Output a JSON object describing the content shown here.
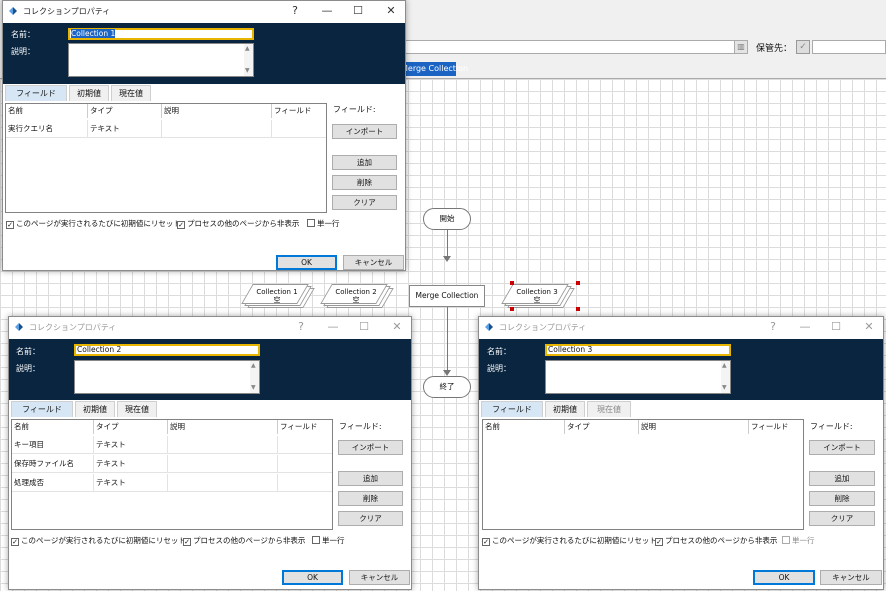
{
  "background": {
    "save_to_label": "保管先：",
    "process_tab": "Merge Collection",
    "scroll_glyph": "▥",
    "check_glyph": "✓",
    "flow": {
      "start": "開始",
      "end": "終了",
      "merge_stage": "Merge Collection",
      "collections": [
        {
          "name": "Collection 1",
          "sub": "空"
        },
        {
          "name": "Collection 2",
          "sub": "空"
        },
        {
          "name": "Collection 3",
          "sub": "空"
        }
      ]
    }
  },
  "dialogs": [
    {
      "title": "コレクションプロパティ",
      "help": "?",
      "min": "—",
      "max": "☐",
      "close": "✕",
      "name_label": "名前：",
      "name_value": "Collection 1",
      "desc_label": "説明：",
      "tabs": [
        "フィールド",
        "初期値",
        "現在値"
      ],
      "columns": [
        "名前",
        "タイプ",
        "説明",
        "フィールド"
      ],
      "rows": [
        [
          "実行クエリ名",
          "テキスト",
          "",
          ""
        ]
      ],
      "fields_label": "フィールド:",
      "import": "インポート",
      "add": "追加",
      "delete": "削除",
      "clear": "クリア",
      "check_reset": "このページが実行されるたびに初期値にリセット",
      "check_hide": "プロセスの他のページから非表示",
      "check_single": "単一行",
      "ok": "OK",
      "cancel": "キャンセル"
    },
    {
      "title": "コレクションプロパティ",
      "help": "?",
      "min": "—",
      "max": "☐",
      "close": "✕",
      "name_label": "名前：",
      "name_value": "Collection 2",
      "desc_label": "説明：",
      "tabs": [
        "フィールド",
        "初期値",
        "現在値"
      ],
      "columns": [
        "名前",
        "タイプ",
        "説明",
        "フィールド"
      ],
      "rows": [
        [
          "キー項目",
          "テキスト",
          "",
          ""
        ],
        [
          "保存時ファイル名",
          "テキスト",
          "",
          ""
        ],
        [
          "処理成否",
          "テキスト",
          "",
          ""
        ]
      ],
      "fields_label": "フィールド:",
      "import": "インポート",
      "add": "追加",
      "delete": "削除",
      "clear": "クリア",
      "check_reset": "このページが実行されるたびに初期値にリセット",
      "check_hide": "プロセスの他のページから非表示",
      "check_single": "単一行",
      "ok": "OK",
      "cancel": "キャンセル"
    },
    {
      "title": "コレクションプロパティ",
      "help": "?",
      "min": "—",
      "max": "☐",
      "close": "✕",
      "name_label": "名前：",
      "name_value": "Collection 3",
      "desc_label": "説明：",
      "tabs": [
        "フィールド",
        "初期値",
        "現在値"
      ],
      "columns": [
        "名前",
        "タイプ",
        "説明",
        "フィールド"
      ],
      "rows": [],
      "fields_label": "フィールド:",
      "import": "インポート",
      "add": "追加",
      "delete": "削除",
      "clear": "クリア",
      "check_reset": "このページが実行されるたびに初期値にリセット",
      "check_hide": "プロセスの他のページから非表示",
      "check_single": "単一行",
      "ok": "OK",
      "cancel": "キャンセル"
    }
  ],
  "check_mark": "✓",
  "scroll_up": "▲",
  "scroll_down": "▼",
  "colors": {
    "header": "#0a2540",
    "name_border": "#e7b400",
    "selection": "#1b64c4",
    "active_tab": "#d6e6f5"
  }
}
